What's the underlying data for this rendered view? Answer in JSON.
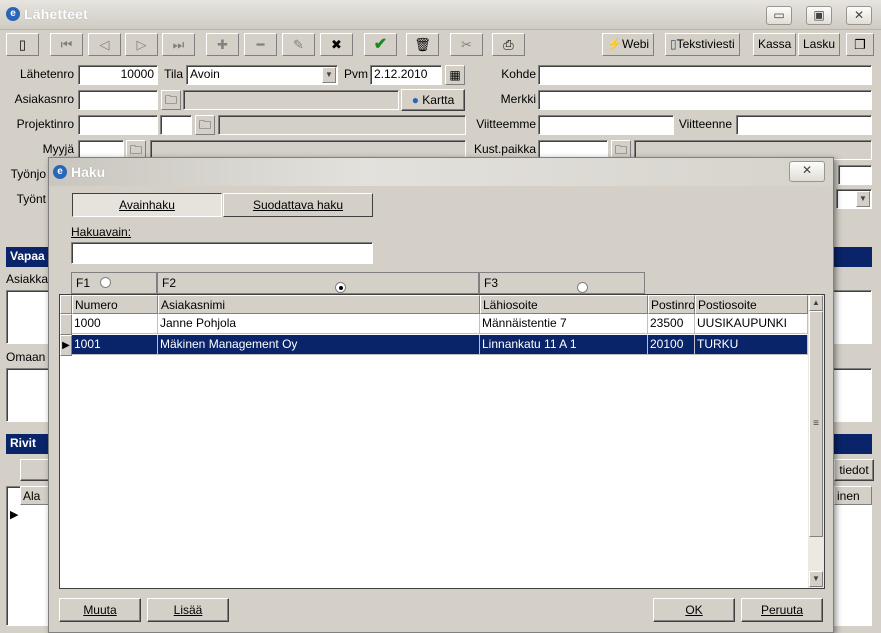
{
  "window": {
    "title": "Lähetteet",
    "minimize": "▭",
    "maximize": "▣",
    "close": "✕"
  },
  "toolbar": {
    "webi": "Webi",
    "tekstiviesti": "Tekstiviesti",
    "kassa": "Kassa",
    "lasku": "Lasku"
  },
  "form": {
    "lahetenro_label": "Lähetenro",
    "lahetenro_value": "10000",
    "tila_label": "Tila",
    "tila_value": "Avoin",
    "pvm_label": "Pvm",
    "pvm_value": "2.12.2010",
    "kohde_label": "Kohde",
    "asiakasnro_label": "Asiakasnro",
    "kartta": "Kartta",
    "merkki_label": "Merkki",
    "projektinro_label": "Projektinro",
    "viitteemme_label": "Viitteemme",
    "viitteenne_label": "Viitteenne",
    "myyja_label": "Myyjä",
    "kustpaikka_label": "Kust.paikka",
    "tyonjo_label": "Työnjo",
    "tyont_label": "Työnt"
  },
  "sections": {
    "vapaa": "Vapaa",
    "asiakka": "Asiakka",
    "omaan": "Omaan",
    "rivit": "Rivit",
    "ala": "Ala",
    "tiedot_btn": "tiedot",
    "inen": "inen"
  },
  "dialog": {
    "title": "Haku",
    "close": "✕",
    "tab_avainhaku": "Avainhaku",
    "tab_suodattava": "Suodattava haku",
    "hakuavain_label": "Hakuavain:",
    "hakuavain_value": "",
    "f1": "F1",
    "f2": "F2",
    "f3": "F3",
    "columns": [
      "Numero",
      "Asiakasnimi",
      "Lähiosoite",
      "Postinro",
      "Postiosoite"
    ],
    "rows": [
      [
        "1000",
        "Janne Pohjola",
        "Männäistentie 7",
        "23500",
        "UUSIKAUPUNKI"
      ],
      [
        "1001",
        "Mäkinen Management Oy",
        "Linnankatu 11 A 1",
        "20100",
        "TURKU"
      ]
    ],
    "selected_row": 1,
    "btn_muuta": "Muuta",
    "btn_lisaa": "Lisää",
    "btn_ok": "OK",
    "btn_peruuta": "Peruuta"
  }
}
